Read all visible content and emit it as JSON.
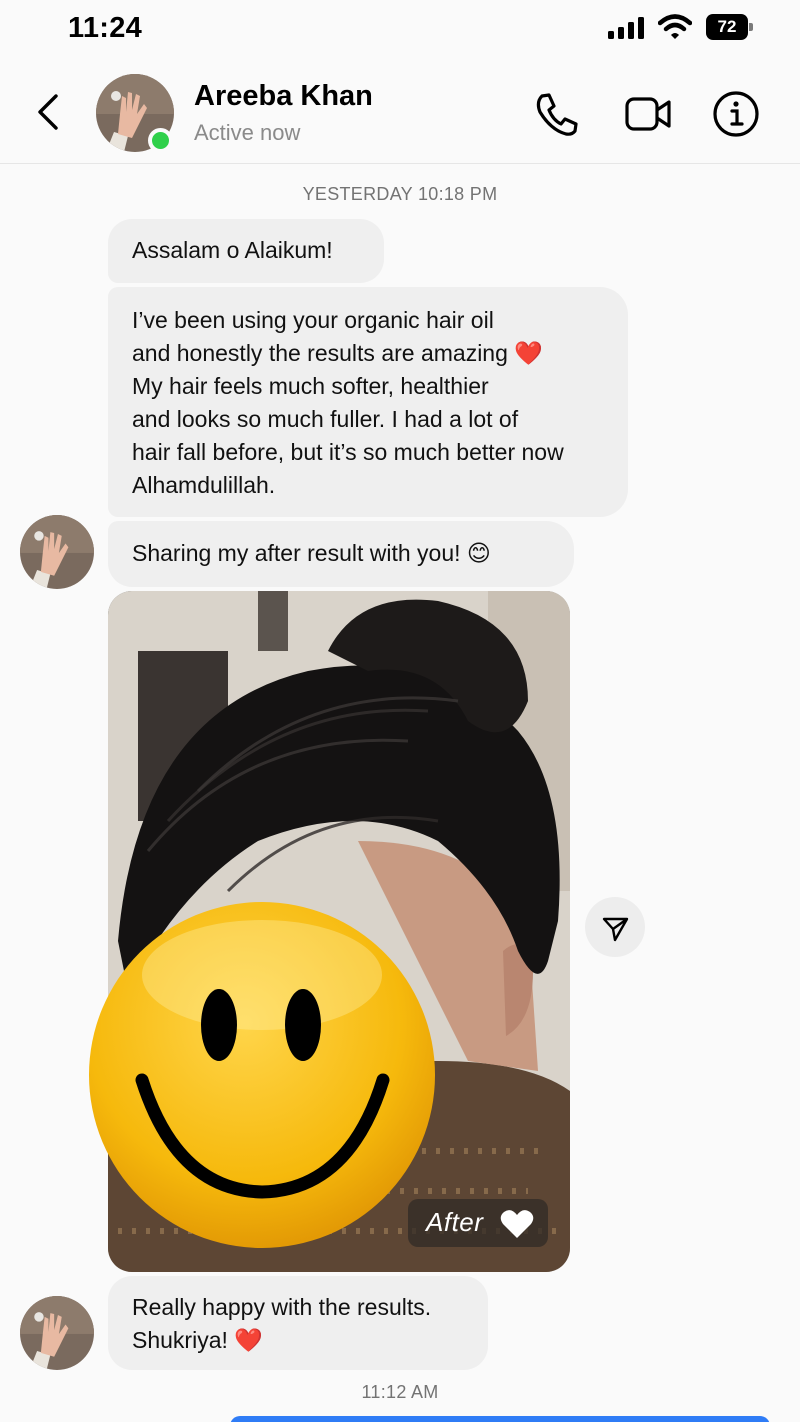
{
  "status_bar": {
    "time": "11:24",
    "battery": "72"
  },
  "header": {
    "contact_name": "Areeba Khan",
    "contact_status": "Active now",
    "icons": [
      "back-icon",
      "phone-icon",
      "video-icon",
      "info-icon"
    ]
  },
  "chat": {
    "timestamp_top": "YESTERDAY 10:18 PM",
    "messages": [
      {
        "text": "Assalam o Alaikum!"
      },
      {
        "text": "I’ve been using your organic hair oil\nand honestly the results are amazing ❤️\nMy hair feels much softer, healthier\nand looks so much fuller. I had a lot of\nhair fall before, but it’s so much better now\nAlhamdulillah."
      },
      {
        "text": "Sharing my after result with you! 😊"
      },
      {
        "text": "Really happy with the results.\nShukriya! ❤️"
      }
    ],
    "photo_tag": "After",
    "timestamp_bottom": "11:12 AM"
  },
  "colors": {
    "online": "#2fd04a",
    "bubble": "#efefef",
    "accent": "#2f7cf6",
    "heart": "#e0202e"
  }
}
